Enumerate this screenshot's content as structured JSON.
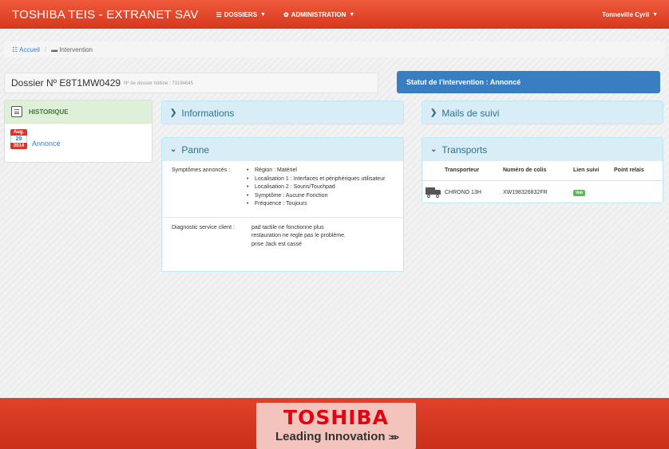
{
  "navbar": {
    "brand": "TOSHIBA TEIS - EXTRANET SAV",
    "menus": [
      {
        "label": "DOSSIERS",
        "icon": "list-icon"
      },
      {
        "label": "ADMINISTRATION",
        "icon": "gear-icon"
      }
    ],
    "user": "Tonneville Cyril",
    "color": "#e04a2d"
  },
  "breadcrumb": {
    "home": "Accueil",
    "separator": "/",
    "current": "Intervention"
  },
  "dossier": {
    "title": "Dossier Nº E8T1MW0429",
    "hotline": "Nº de dossier hotline : 73194645"
  },
  "statut": {
    "label": "Statut de l'intervention : Annoncé",
    "color": "#3a7ec2"
  },
  "historique": {
    "title": "HISTORIQUE",
    "entries": [
      {
        "month": "Aug.",
        "day": "29",
        "year": "2014",
        "label": "Annoncé"
      }
    ]
  },
  "panels": {
    "informations": "Informations",
    "mails": "Mails de suivi",
    "panne": "Panne",
    "transports": "Transports"
  },
  "panne": {
    "symptomes_label": "Symptômes annoncés :",
    "symptomes": [
      "Région : Matériel",
      "Localisation 1 : Interfaces et périphériques utilisateur",
      "Localisation 2 : Souris/Touchpad",
      "Symptôme : Aucune Fonction",
      "Fréquence : Toujours"
    ],
    "diagnostic_label": "Diagnostic service client :",
    "diagnostic_lines": [
      "pad tactile ne fonctionne plus",
      "restauration ne regle pas le problème.",
      "prise Jack est cassé"
    ]
  },
  "transports": {
    "headers": [
      "Transporteur",
      "Numéro de colis",
      "Lien suivi",
      "Point relais"
    ],
    "rows": [
      {
        "transporteur": "CHRONO 13H",
        "colis": "XW198326832FR",
        "lien": "Voir",
        "relais": ""
      }
    ]
  },
  "footer": {
    "logo": "TOSHIBA",
    "tagline": "Leading Innovation",
    "arrows": ">>>"
  }
}
